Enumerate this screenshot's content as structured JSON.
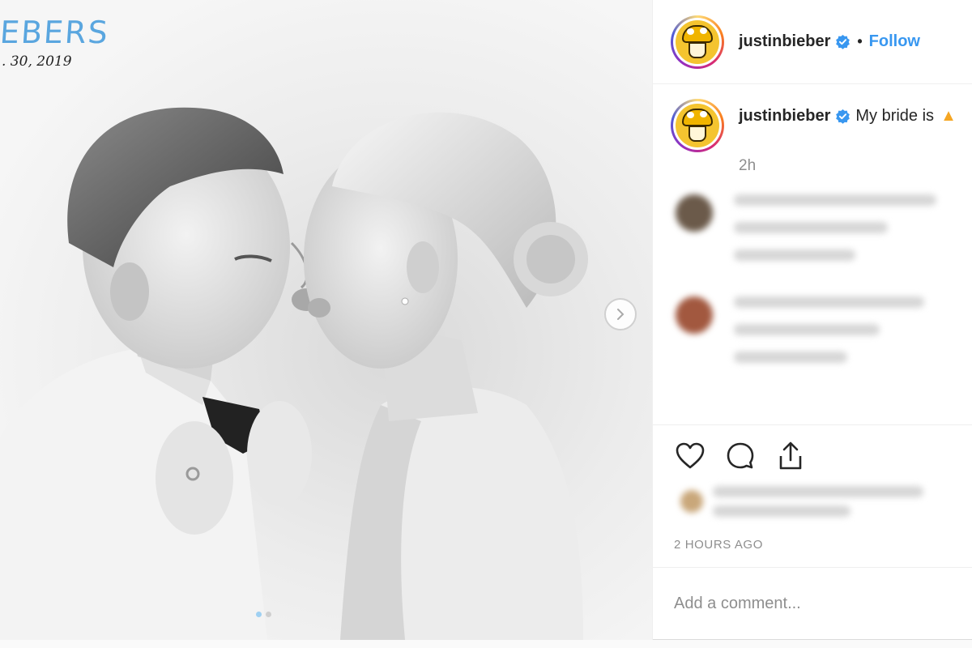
{
  "post": {
    "image": {
      "overlay_title": "EBERS",
      "overlay_date": ". 30, 2019",
      "carousel_dots": 2,
      "active_dot": 0,
      "next_icon": "chevron-right-icon"
    },
    "header": {
      "username": "justinbieber",
      "verified_icon": "verified-badge-icon",
      "separator": "•",
      "follow_label": "Follow"
    },
    "caption": {
      "username": "justinbieber",
      "text": "My bride is",
      "emoji_icon": "fire-emoji-icon",
      "time": "2h"
    },
    "actions": {
      "like_icon": "heart-icon",
      "comment_icon": "comment-bubble-icon",
      "share_icon": "share-icon"
    },
    "timestamp": "2 HOURS AGO",
    "add_comment": {
      "placeholder": "Add a comment..."
    },
    "colors": {
      "accent": "#3897f0",
      "overlay_title": "#5aa6df",
      "secondary_text": "#8e8e8e",
      "border": "#efefef"
    }
  }
}
